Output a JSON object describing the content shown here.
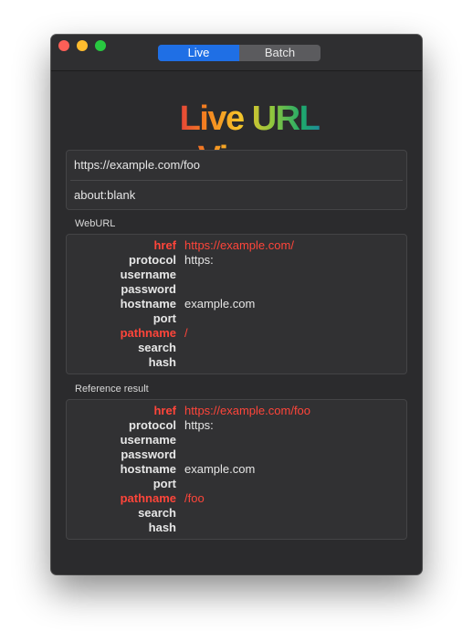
{
  "window": {
    "tabs": [
      {
        "label": "Live",
        "active": true
      },
      {
        "label": "Batch",
        "active": false
      }
    ],
    "logo_text": "Live URL Viewer"
  },
  "inputs": {
    "items": [
      "https://example.com/foo",
      "about:blank"
    ]
  },
  "webURL": {
    "title": "WebURL",
    "rows": [
      {
        "key": "href",
        "value": "https://example.com/",
        "highlight": true
      },
      {
        "key": "protocol",
        "value": "https:",
        "highlight": false
      },
      {
        "key": "username",
        "value": "",
        "highlight": false
      },
      {
        "key": "password",
        "value": "",
        "highlight": false
      },
      {
        "key": "hostname",
        "value": "example.com",
        "highlight": false
      },
      {
        "key": "port",
        "value": "",
        "highlight": false
      },
      {
        "key": "pathname",
        "value": "/",
        "highlight": true
      },
      {
        "key": "search",
        "value": "",
        "highlight": false
      },
      {
        "key": "hash",
        "value": "",
        "highlight": false
      }
    ]
  },
  "reference": {
    "title": "Reference result",
    "rows": [
      {
        "key": "href",
        "value": "https://example.com/foo",
        "highlight": true
      },
      {
        "key": "protocol",
        "value": "https:",
        "highlight": false
      },
      {
        "key": "username",
        "value": "",
        "highlight": false
      },
      {
        "key": "password",
        "value": "",
        "highlight": false
      },
      {
        "key": "hostname",
        "value": "example.com",
        "highlight": false
      },
      {
        "key": "port",
        "value": "",
        "highlight": false
      },
      {
        "key": "pathname",
        "value": "/foo",
        "highlight": true
      },
      {
        "key": "search",
        "value": "",
        "highlight": false
      },
      {
        "key": "hash",
        "value": "",
        "highlight": false
      }
    ]
  },
  "colors": {
    "highlight": "#ff453a",
    "accent": "#1f6fe5"
  }
}
